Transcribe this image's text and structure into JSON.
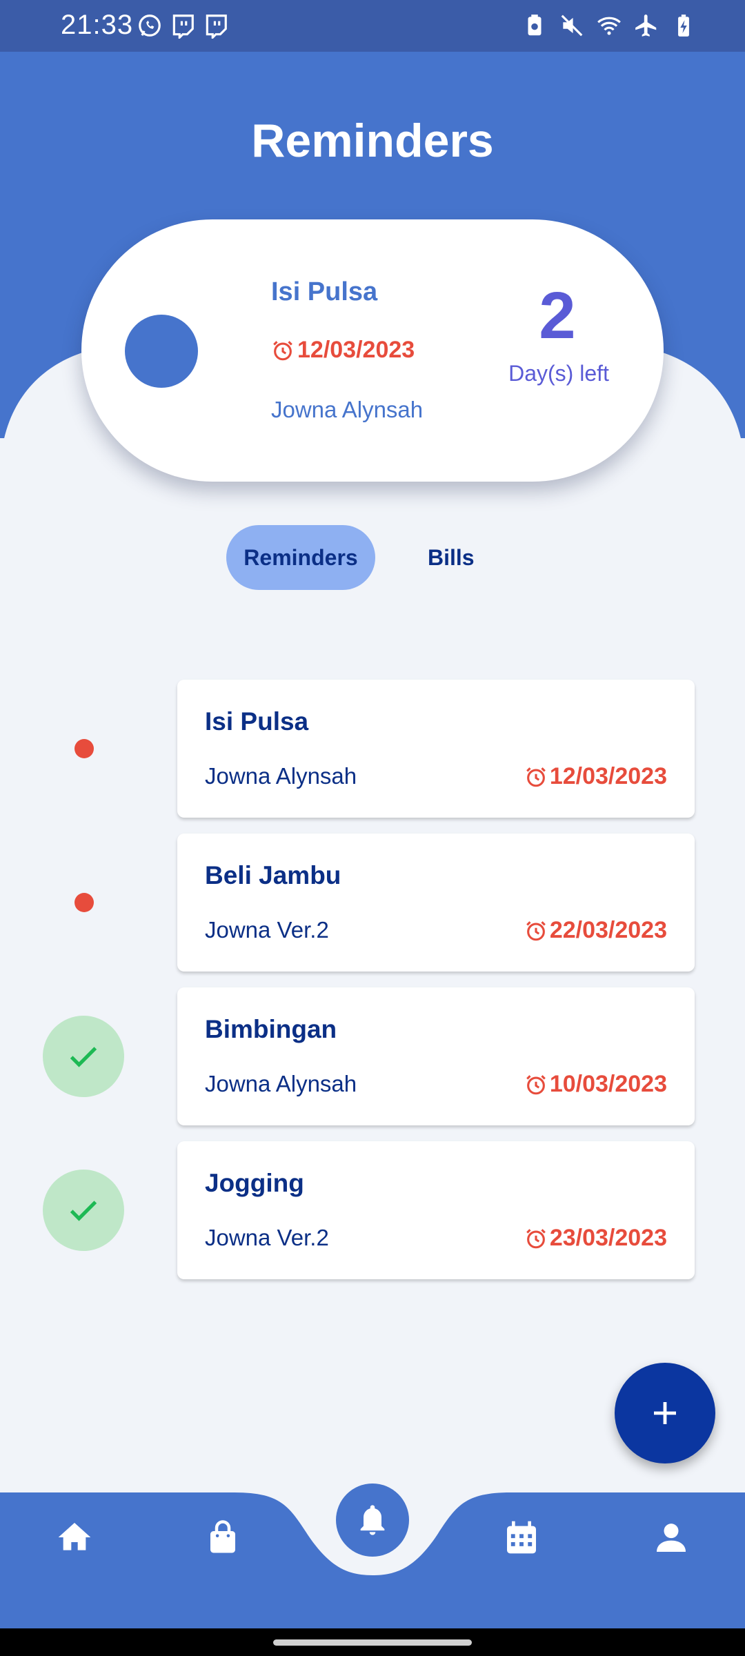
{
  "status_bar": {
    "time": "21:33",
    "left_icons": [
      "whatsapp-icon",
      "twitch-icon",
      "twitch-icon"
    ],
    "right_icons": [
      "battery-saver-icon",
      "mute-icon",
      "wifi-icon",
      "airplane-icon",
      "battery-charging-icon"
    ]
  },
  "header": {
    "title": "Reminders"
  },
  "summary": {
    "title": "Isi Pulsa",
    "date": "12/03/2023",
    "person": "Jowna Alynsah",
    "count": "2",
    "count_label": "Day(s) left"
  },
  "tabs": [
    {
      "label": "Reminders",
      "active": true
    },
    {
      "label": "Bills",
      "active": false
    }
  ],
  "reminders": [
    {
      "title": "Isi Pulsa",
      "person": "Jowna Alynsah",
      "date": "12/03/2023",
      "done": false
    },
    {
      "title": "Beli Jambu",
      "person": "Jowna Ver.2",
      "date": "22/03/2023",
      "done": false
    },
    {
      "title": "Bimbingan",
      "person": "Jowna Alynsah",
      "date": "10/03/2023",
      "done": true
    },
    {
      "title": "Jogging",
      "person": "Jowna Ver.2",
      "date": "23/03/2023",
      "done": true
    }
  ],
  "fab": {
    "icon": "plus-icon"
  },
  "bottom_nav": {
    "items": [
      "home-icon",
      "shopping-bag-icon",
      "bell-icon",
      "calendar-icon",
      "user-icon"
    ],
    "active": "bell-icon"
  },
  "colors": {
    "primary": "#4674CC",
    "dark_blue": "#0B2F86",
    "fab": "#0B36A0",
    "alert_red": "#E74C3C",
    "tab_active": "#8EB0F2",
    "done_bg": "#BFE7C8",
    "done_check": "#1DB954",
    "background": "#F1F4F9",
    "accent_purple": "#5A5BD6"
  }
}
